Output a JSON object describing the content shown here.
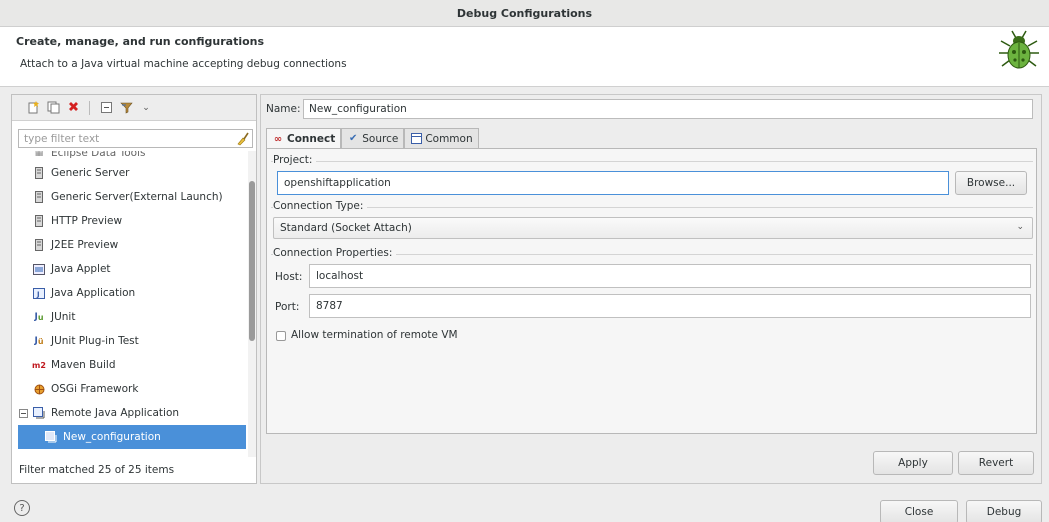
{
  "window": {
    "title": "Debug Configurations"
  },
  "banner": {
    "title": "Create, manage, and run configurations",
    "subtitle": "Attach to a Java virtual machine accepting debug connections",
    "icon": "bug-icon"
  },
  "left": {
    "toolbar": [
      "new-config-icon",
      "duplicate-icon",
      "delete-icon",
      "collapse-all-icon",
      "filter-icon",
      "chevron-down-icon"
    ],
    "filter": {
      "placeholder": "type filter text",
      "value": ""
    },
    "tree": [
      {
        "label": "Eclipse Data Tools",
        "icon": "data-tools-icon"
      },
      {
        "label": "Generic Server",
        "icon": "server-icon"
      },
      {
        "label": "Generic Server(External Launch)",
        "icon": "server-icon"
      },
      {
        "label": "HTTP Preview",
        "icon": "server-icon"
      },
      {
        "label": "J2EE Preview",
        "icon": "server-icon"
      },
      {
        "label": "Java Applet",
        "icon": "applet-icon"
      },
      {
        "label": "Java Application",
        "icon": "java-app-icon"
      },
      {
        "label": "JUnit",
        "icon": "junit-icon"
      },
      {
        "label": "JUnit Plug-in Test",
        "icon": "junit-plugin-icon"
      },
      {
        "label": "Maven Build",
        "icon": "maven-icon"
      },
      {
        "label": "OSGi Framework",
        "icon": "osgi-icon"
      },
      {
        "label": "Remote Java Application",
        "icon": "remote-java-icon"
      },
      {
        "label": "New_configuration",
        "icon": "remote-config-icon"
      }
    ],
    "status": "Filter matched 25 of 25 items"
  },
  "right": {
    "name_label": "Name:",
    "name_value": "New_configuration",
    "tabs": [
      {
        "label": "Connect",
        "icon": "connect-icon",
        "active": true
      },
      {
        "label": "Source",
        "icon": "source-icon",
        "active": false
      },
      {
        "label": "Common",
        "icon": "common-icon",
        "active": false
      }
    ],
    "project": {
      "label": "Project:",
      "value": "openshiftapplication",
      "browse": "Browse..."
    },
    "connection_type": {
      "label": "Connection Type:",
      "value": "Standard (Socket Attach)"
    },
    "connection_props": {
      "label": "Connection Properties:",
      "host_label": "Host:",
      "host_value": "localhost",
      "port_label": "Port:",
      "port_value": "8787"
    },
    "allow_termination": {
      "label": "Allow termination of remote VM",
      "checked": false
    },
    "apply": "Apply",
    "revert": "Revert"
  },
  "footer": {
    "help": "?",
    "close": "Close",
    "debug": "Debug"
  }
}
